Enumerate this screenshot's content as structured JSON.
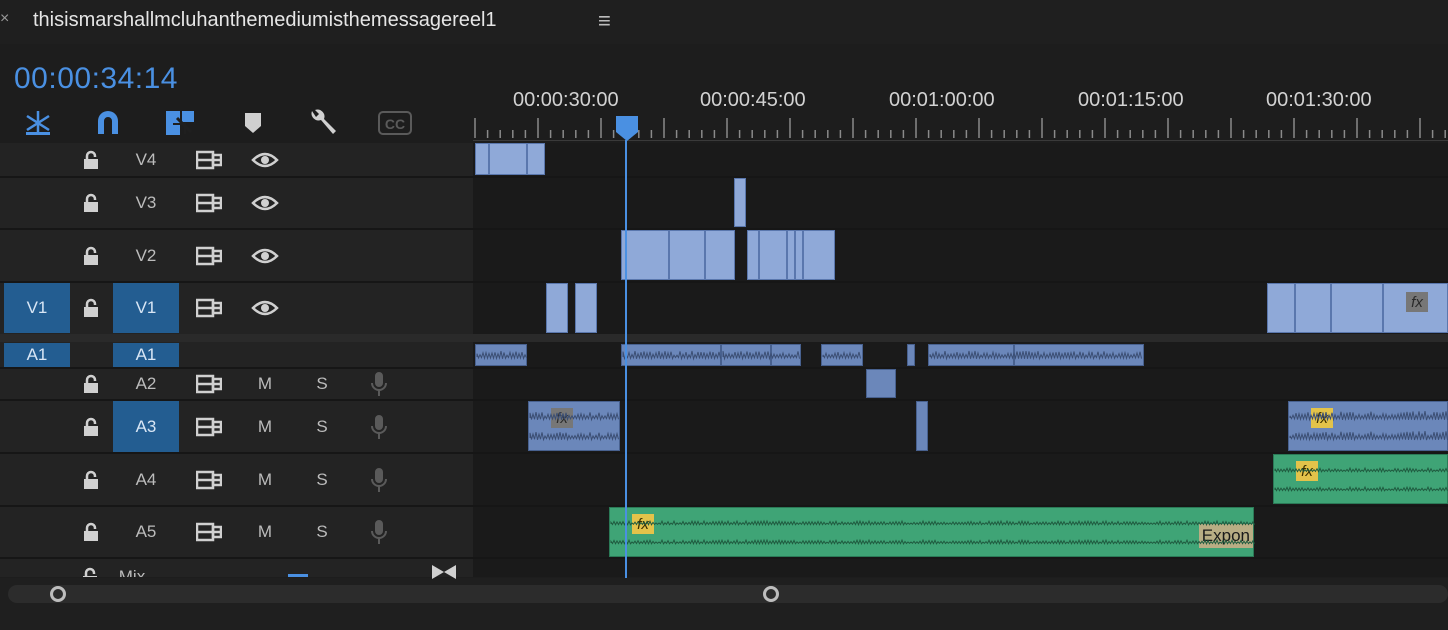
{
  "panel": {
    "close_glyph": "×",
    "title": "thisismarshallmcluhanthemediumisthemessagereel1",
    "menu_glyph": "≡"
  },
  "timecode": "00:00:34:14",
  "tools": [
    "snap-icon",
    "magnet-icon",
    "linked-selection-icon",
    "add-marker-icon",
    "wrench-icon",
    "captions-icon"
  ],
  "tools_cc_label": "CC",
  "ruler": {
    "labels": [
      "00:00:30:00",
      "00:00:45:00",
      "00:01:00:00",
      "00:01:15:00",
      "00:01:30:00"
    ]
  },
  "tracks": {
    "video": [
      {
        "name": "V4",
        "source_patch": "",
        "target": false
      },
      {
        "name": "V3",
        "source_patch": "",
        "target": false
      },
      {
        "name": "V2",
        "source_patch": "",
        "target": false
      },
      {
        "name": "V1",
        "source_patch": "V1",
        "target": true
      }
    ],
    "audio": [
      {
        "name": "A1",
        "source_patch": "A1",
        "target": true
      },
      {
        "name": "A2",
        "source_patch": "",
        "target": false
      },
      {
        "name": "A3",
        "source_patch": "",
        "target": true
      },
      {
        "name": "A4",
        "source_patch": "",
        "target": false
      },
      {
        "name": "A5",
        "source_patch": "",
        "target": false
      }
    ],
    "mute_label": "M",
    "solo_label": "S",
    "mix_label": "Mix"
  },
  "clips": {
    "transition_label": "Expon",
    "fx_label": "fx"
  },
  "colors": {
    "accent": "#4a90e2",
    "video_clip": "#8fa9d8",
    "audio_clip": "#6b87ba",
    "audio_clip_green": "#3fa476",
    "render_bar": "#e8df3a"
  }
}
